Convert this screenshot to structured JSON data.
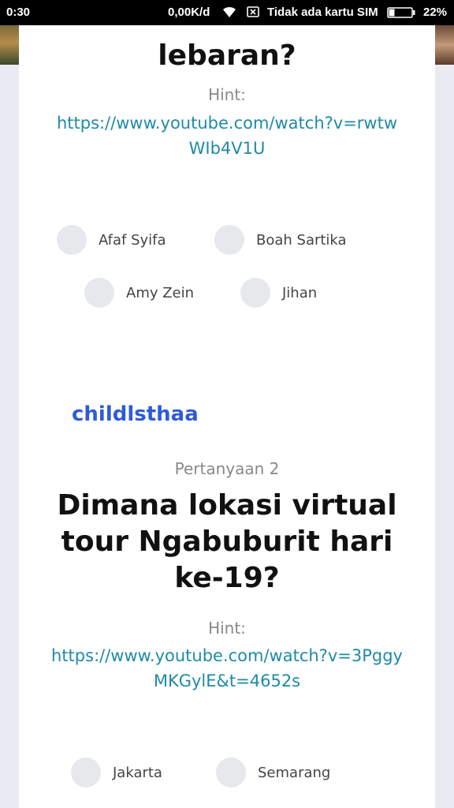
{
  "status_bar": {
    "time": "0:30",
    "network_speed": "0,00K/d",
    "sim_status": "Tidak ada kartu SIM",
    "battery": "22%"
  },
  "question1": {
    "title_visible": "lebaran?",
    "hint_label": "Hint:",
    "hint_url": "https://www.youtube.com/watch?v=rwtwWIb4V1U",
    "options": [
      "Afaf Syifa",
      "Boah Sartika",
      "Amy Zein",
      "Jihan"
    ]
  },
  "username": "childlsthaa",
  "question2": {
    "number_label": "Pertanyaan 2",
    "title": "Dimana lokasi virtual tour Ngabuburit hari ke-19?",
    "hint_label": "Hint:",
    "hint_url": "https://www.youtube.com/watch?v=3PggyMKGylE&t=4652s",
    "options": [
      "Jakarta",
      "Semarang"
    ]
  },
  "colors": {
    "link": "#1f8aa8",
    "username": "#2f5bd9",
    "radio": "#e7e8ec",
    "page_background": "#e9ebf3"
  }
}
